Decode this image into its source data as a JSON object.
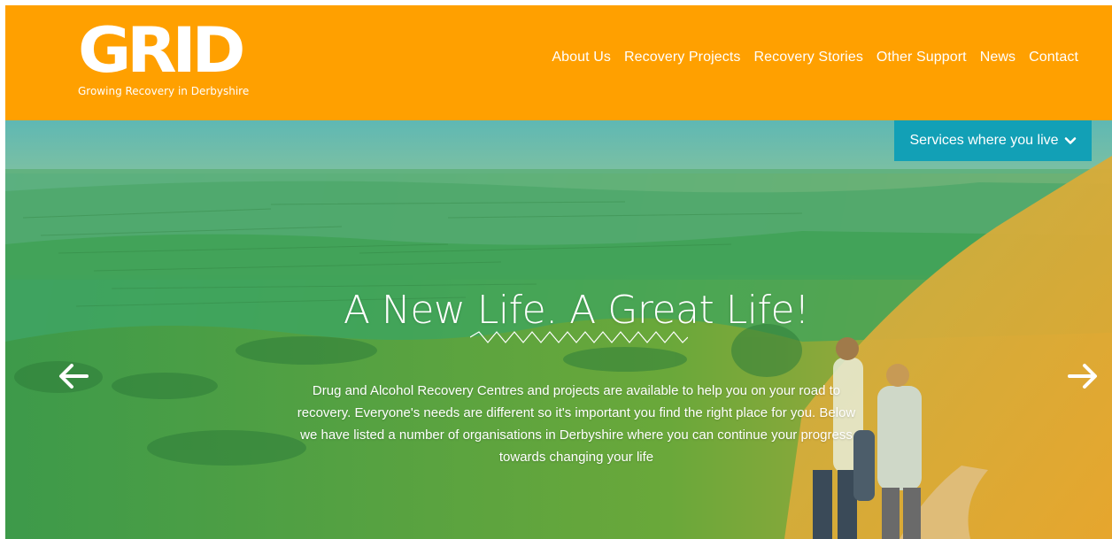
{
  "header": {
    "logo_text": "GRID",
    "tagline": "Growing Recovery in Derbyshire",
    "nav": [
      {
        "label": "About Us"
      },
      {
        "label": "Recovery Projects"
      },
      {
        "label": "Recovery Stories"
      },
      {
        "label": "Other Support"
      },
      {
        "label": "News"
      },
      {
        "label": "Contact"
      }
    ]
  },
  "hero": {
    "services_button": "Services where you live",
    "title": "A New Life. A Great Life!",
    "description": "Drug and Alcohol Recovery Centres and projects are available to help you on your road to recovery. Everyone's needs are different so it's important you find the right place for you. Below we have listed a number of organisations in Derbyshire where you can continue your progress towards changing your life",
    "prev_icon": "arrow-left-icon",
    "next_icon": "arrow-right-icon"
  },
  "colors": {
    "header_bg": "#ffa000",
    "services_button_bg": "#12a0b6",
    "text": "#ffffff"
  }
}
